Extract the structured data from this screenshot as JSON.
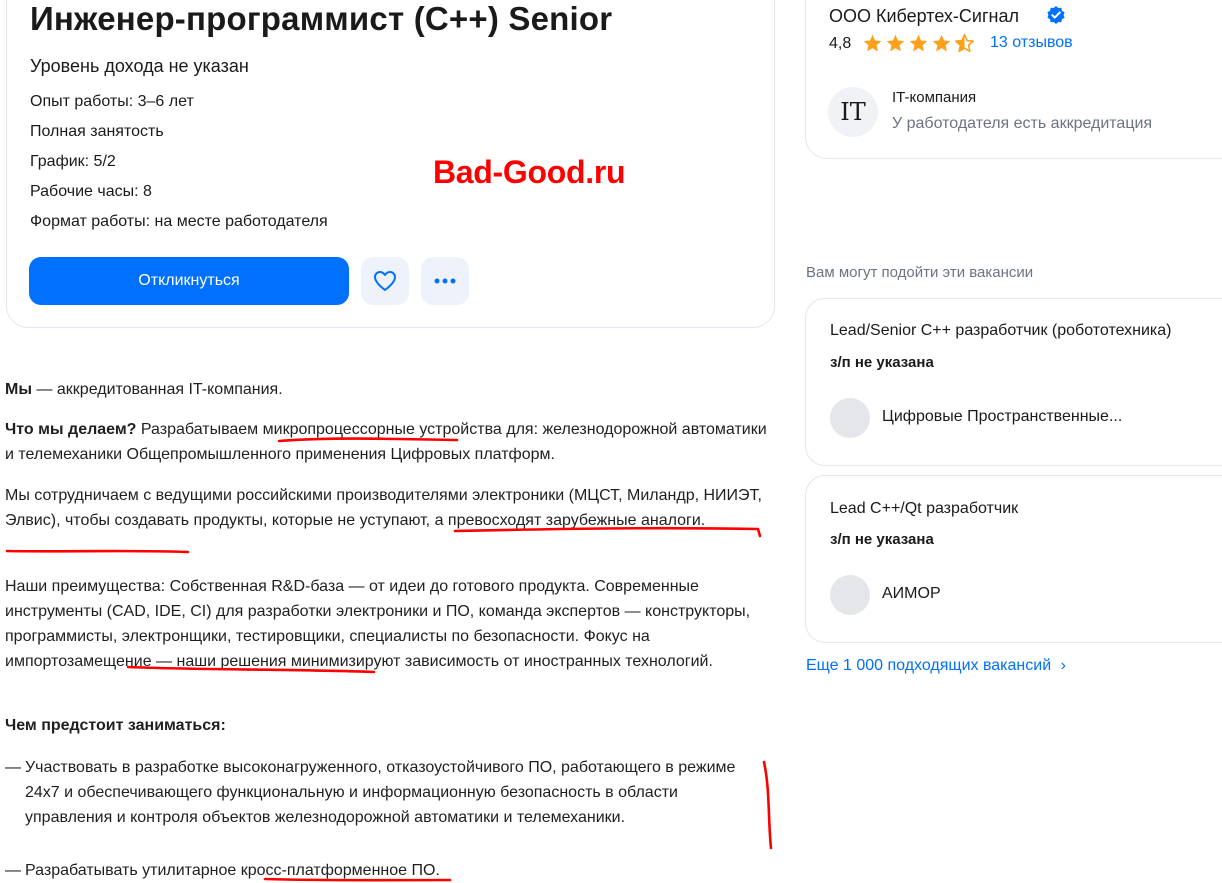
{
  "vacancy": {
    "title": "Инженер-программист (C++) Senior",
    "salary": "Уровень дохода не указан",
    "details": [
      "Опыт работы: 3–6 лет",
      "Полная занятость",
      "График: 5/2",
      "Рабочие часы: 8",
      "Формат работы: на месте работодателя"
    ],
    "apply_label": "Откликнуться"
  },
  "watermark": "Bad-Good.ru",
  "description": {
    "p1_bold": "Мы",
    "p1_rest": " — аккредитованная IT-компания.",
    "p2_bold": "Что мы делаем?",
    "p2_rest": " Разрабатываем микропроцессорные устройства для: железнодорожной автоматики и телемеханики Общепромышленного применения Цифровых платформ.",
    "p3": "Мы сотрудничаем с ведущими российскими производителями электроники (МЦСТ, Миландр, НИИЭТ, Элвис), чтобы создавать продукты, которые не уступают, а превосходят зарубежные аналоги.",
    "p4": "Наши преимущества: Собственная R&D-база — от идеи до готового продукта. Современные инструменты (CAD, IDE, CI) для разработки электроники и ПО, команда экспертов — конструкторы, программисты, электронщики, тестировщики, специалисты по безопасности. Фокус на импортозамещение — наши решения минимизируют зависимость от иностранных технологий.",
    "duties_heading": "Чем предстоит заниматься:",
    "duties": [
      "Участвовать в разработке высоконагруженного, отказоустойчивого ПО, работающего в режиме 24x7 и обеспечивающего функциональную и информационную безопасность в области управления и контроля объектов железнодорожной автоматики и телемеханики.",
      "Разрабатывать утилитарное кросс-платформенное ПО."
    ]
  },
  "company": {
    "name": "ООО Кибертех-Сигнал",
    "rating": "4,8",
    "reviews": "13 отзывов",
    "logo_text": "IT",
    "type_label": "IT-компания",
    "accreditation": "У работодателя есть аккредитация"
  },
  "recommendations": {
    "heading": "Вам могут подойти эти вакансии",
    "items": [
      {
        "title": "Lead/Senior C++ разработчик (робототехника)",
        "salary": "з/п не указана",
        "company": "Цифровые Пространственные..."
      },
      {
        "title": "Lead C++/Qt разработчик",
        "salary": "з/п не указана",
        "company": "АИМОР"
      }
    ],
    "more_label": "Еще 1 000 подходящих вакансий",
    "more_chevron": "›"
  },
  "colors": {
    "accent": "#0070ff",
    "annotation": "#ff0000",
    "star": "#ff9f1a"
  },
  "icons": [
    "heart-icon",
    "more-dots-icon",
    "verified-icon",
    "star-icon",
    "chevron-right-icon"
  ]
}
